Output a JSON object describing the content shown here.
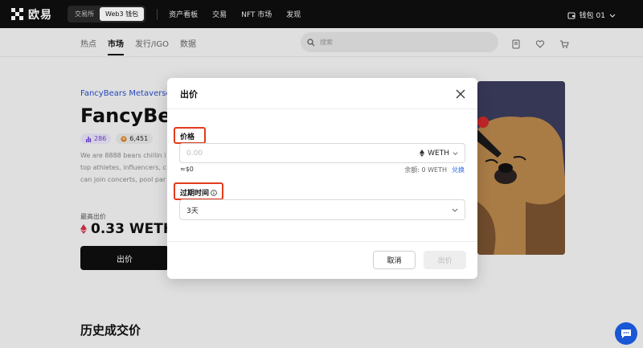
{
  "brand": {
    "name": "欧易"
  },
  "mode_switch": {
    "exchange": "交易所",
    "web3": "Web3 钱包"
  },
  "topnav": [
    "资产看板",
    "交易",
    "NFT 市场",
    "发现"
  ],
  "wallet": {
    "label": "钱包 01"
  },
  "subnav": {
    "tabs": [
      "热点",
      "市场",
      "发行/IGO",
      "数据"
    ],
    "active": "市场"
  },
  "search": {
    "placeholder": "搜索"
  },
  "collection": {
    "name": "FancyBears Metaverse",
    "title": "FancyBear",
    "stats": {
      "holders": "286",
      "items": "6,451"
    },
    "description_lines": [
      "We are 8888 bears chillin i",
      "top athletes, influencers, c",
      "can join concerts, pool par"
    ],
    "best_bid_label": "最高出价",
    "best_bid_value": "0.33 WETH",
    "bid_button": "出价",
    "history_title": "历史成交价"
  },
  "modal": {
    "title": "出价",
    "price_label": "价格",
    "price_placeholder": "0.00",
    "currency": "WETH",
    "usd_value": "≈$0",
    "balance_text": "余额: 0 WETH",
    "exchange_link": "兑换",
    "expiry_label": "过期时间",
    "expiry_value": "3天",
    "cancel_button": "取消",
    "confirm_button": "出价"
  },
  "colors": {
    "accent_blue": "#2a4fcf",
    "highlight_red": "#e23b1c",
    "topbar": "#0f0f0f"
  }
}
